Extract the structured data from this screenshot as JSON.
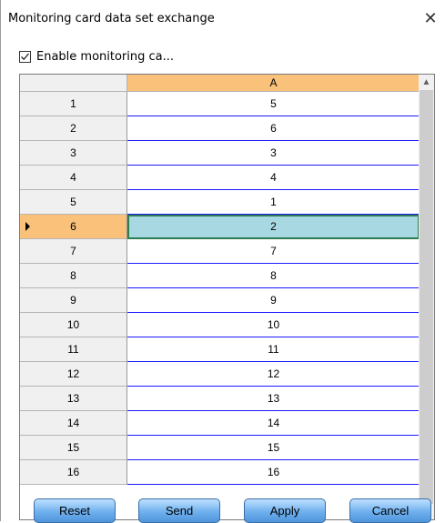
{
  "window": {
    "title": "Monitoring card data set exchange",
    "close_symbol": "✕"
  },
  "checkbox": {
    "label": "Enable monitoring ca...",
    "checked": true
  },
  "grid": {
    "column_header": "A",
    "selected_row": 6,
    "rows": [
      {
        "num": "1",
        "value": "5"
      },
      {
        "num": "2",
        "value": "6"
      },
      {
        "num": "3",
        "value": "3"
      },
      {
        "num": "4",
        "value": "4"
      },
      {
        "num": "5",
        "value": "1"
      },
      {
        "num": "6",
        "value": "2"
      },
      {
        "num": "7",
        "value": "7"
      },
      {
        "num": "8",
        "value": "8"
      },
      {
        "num": "9",
        "value": "9"
      },
      {
        "num": "10",
        "value": "10"
      },
      {
        "num": "11",
        "value": "11"
      },
      {
        "num": "12",
        "value": "12"
      },
      {
        "num": "13",
        "value": "13"
      },
      {
        "num": "14",
        "value": "14"
      },
      {
        "num": "15",
        "value": "15"
      },
      {
        "num": "16",
        "value": "16"
      }
    ]
  },
  "buttons": {
    "reset": "Reset",
    "send": "Send",
    "apply": "Apply",
    "cancel": "Cancel"
  },
  "colors": {
    "header_orange": "#f9c17a",
    "selected_cell": "#a8d8e2",
    "button_blue": "#6fb0ee"
  }
}
